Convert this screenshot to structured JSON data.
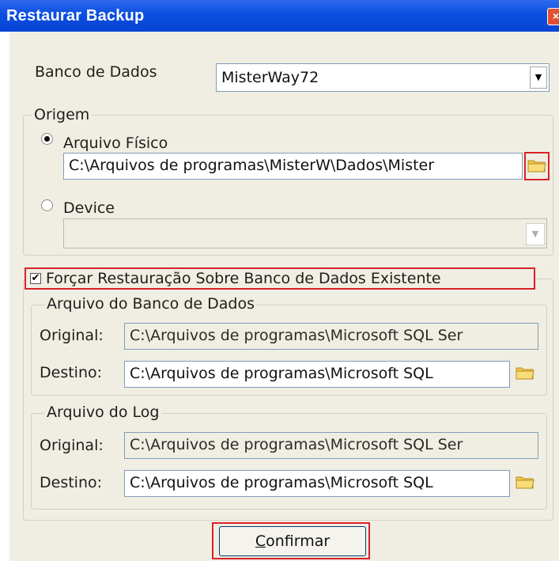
{
  "window": {
    "title": "Restaurar Backup",
    "close_glyph": "×"
  },
  "database": {
    "label": "Banco de Dados",
    "selected": "MisterWay72"
  },
  "origem": {
    "legend": "Origem",
    "arquivo_fisico": {
      "label": "Arquivo Físico",
      "selected": true,
      "path": "C:\\Arquivos de programas\\MisterW\\Dados\\Mister"
    },
    "device": {
      "label": "Device",
      "selected": false,
      "value": ""
    }
  },
  "forcar": {
    "label": "Forçar Restauração Sobre Banco de Dados Existente",
    "checked": true
  },
  "arquivo_banco": {
    "legend": "Arquivo do Banco de Dados",
    "original_label": "Original:",
    "original_value": "C:\\Arquivos de programas\\Microsoft SQL Ser",
    "destino_label": "Destino:",
    "destino_value": "C:\\Arquivos de programas\\Microsoft SQL"
  },
  "arquivo_log": {
    "legend": "Arquivo do Log",
    "original_label": "Original:",
    "original_value": "C:\\Arquivos de programas\\Microsoft SQL Ser",
    "destino_label": "Destino:",
    "destino_value": "C:\\Arquivos de programas\\Microsoft SQL"
  },
  "confirm": {
    "accel": "C",
    "rest": "onfirmar"
  },
  "colors": {
    "titlebar": "#0b4fe0",
    "panel": "#f0eee2",
    "highlight": "#d9222a",
    "folder": "#f2c94c"
  }
}
